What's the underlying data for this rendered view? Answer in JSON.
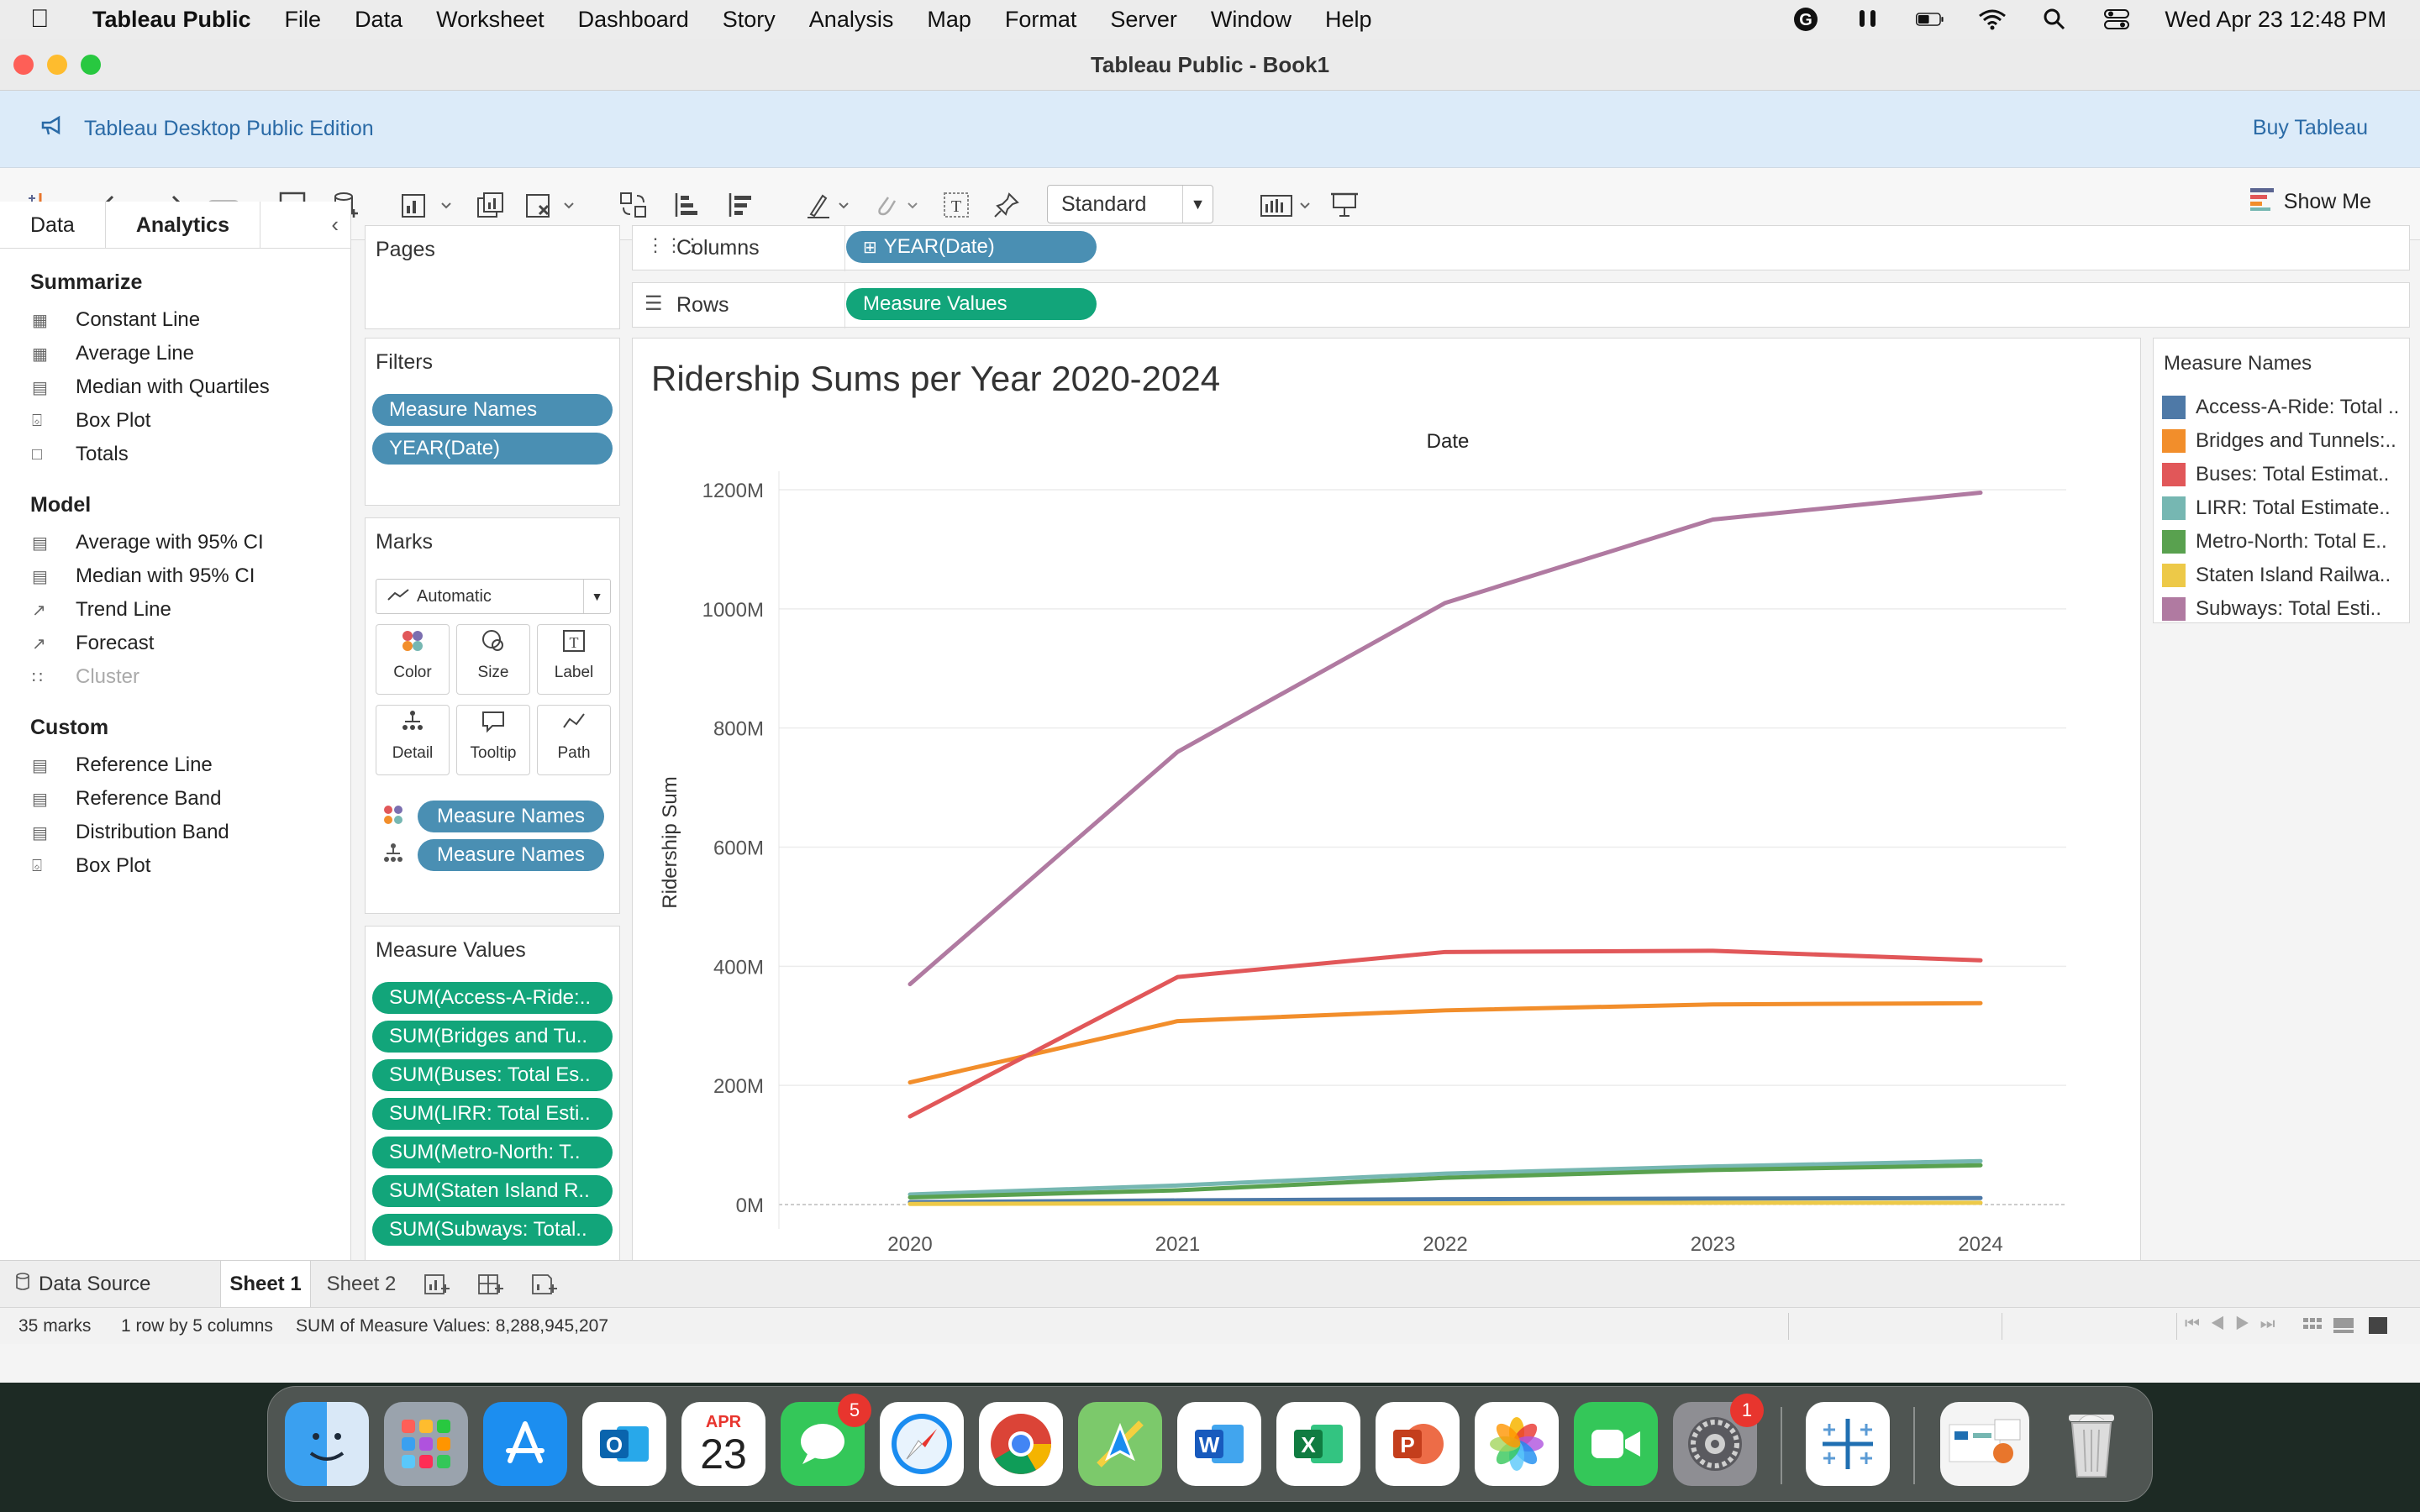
{
  "menubar": {
    "app_name": "Tableau Public",
    "items": [
      "File",
      "Data",
      "Worksheet",
      "Dashboard",
      "Story",
      "Analysis",
      "Map",
      "Format",
      "Server",
      "Window",
      "Help"
    ],
    "clock": "Wed Apr 23  12:48 PM"
  },
  "window": {
    "title": "Tableau Public - Book1",
    "banner_text": "Tableau Desktop Public Edition",
    "buy_label": "Buy Tableau"
  },
  "toolbar": {
    "fit_select": "Standard",
    "show_me": "Show Me"
  },
  "left_pane": {
    "tabs": [
      "Data",
      "Analytics"
    ],
    "active_tab": "Analytics",
    "sections": [
      {
        "title": "Summarize",
        "items": [
          "Constant Line",
          "Average Line",
          "Median with Quartiles",
          "Box Plot",
          "Totals"
        ]
      },
      {
        "title": "Model",
        "items": [
          "Average with 95% CI",
          "Median with 95% CI",
          "Trend Line",
          "Forecast",
          "Cluster"
        ]
      },
      {
        "title": "Custom",
        "items": [
          "Reference Line",
          "Reference Band",
          "Distribution Band",
          "Box Plot"
        ]
      }
    ]
  },
  "pages": {
    "title": "Pages"
  },
  "filters": {
    "title": "Filters",
    "pills": [
      "Measure Names",
      "YEAR(Date)"
    ]
  },
  "marks": {
    "title": "Marks",
    "type": "Automatic",
    "buttons": [
      "Color",
      "Size",
      "Label",
      "Detail",
      "Tooltip",
      "Path"
    ],
    "pills": [
      "Measure Names",
      "Measure Names"
    ]
  },
  "measure_values": {
    "title": "Measure Values",
    "pills": [
      "SUM(Access-A-Ride:..",
      "SUM(Bridges and Tu..",
      "SUM(Buses: Total Es..",
      "SUM(LIRR: Total Esti..",
      "SUM(Metro-North: T..",
      "SUM(Staten Island R..",
      "SUM(Subways: Total.."
    ]
  },
  "shelves": {
    "columns_label": "Columns",
    "columns_pill": "YEAR(Date)",
    "rows_label": "Rows",
    "rows_pill": "Measure Values"
  },
  "legend": {
    "title": "Measure Names",
    "entries": [
      {
        "label": "Access-A-Ride: Total ..",
        "color": "#4e79a7"
      },
      {
        "label": "Bridges and Tunnels:..",
        "color": "#f28e2b"
      },
      {
        "label": "Buses: Total Estimat..",
        "color": "#e15759"
      },
      {
        "label": "LIRR: Total Estimate..",
        "color": "#76b7b2"
      },
      {
        "label": "Metro-North: Total E..",
        "color": "#59a14f"
      },
      {
        "label": "Staten Island Railwa..",
        "color": "#edc948"
      },
      {
        "label": "Subways: Total Esti..",
        "color": "#b07aa1"
      }
    ]
  },
  "chart_data": {
    "type": "line",
    "title": "Ridership Sums per Year 2020-2024",
    "xlabel": "Date",
    "ylabel": "Ridership Sum",
    "x": [
      "2020",
      "2021",
      "2022",
      "2023",
      "2024"
    ],
    "y_ticks": [
      "0M",
      "200M",
      "400M",
      "600M",
      "800M",
      "1000M",
      "1200M"
    ],
    "ylim": [
      0,
      1200
    ],
    "series": [
      {
        "name": "Access-A-Ride: Total ..",
        "color": "#4e79a7",
        "values": [
          4,
          7,
          9,
          10,
          11
        ]
      },
      {
        "name": "Bridges and Tunnels:..",
        "color": "#f28e2b",
        "values": [
          205,
          308,
          326,
          336,
          338
        ]
      },
      {
        "name": "Buses: Total Estimat..",
        "color": "#e15759",
        "values": [
          148,
          382,
          424,
          426,
          410
        ]
      },
      {
        "name": "LIRR: Total Estimate..",
        "color": "#76b7b2",
        "values": [
          17,
          32,
          52,
          64,
          73
        ]
      },
      {
        "name": "Metro-North: Total E..",
        "color": "#59a14f",
        "values": [
          12,
          24,
          45,
          58,
          66
        ]
      },
      {
        "name": "Staten Island Railwa..",
        "color": "#edc948",
        "values": [
          1,
          2,
          2,
          3,
          3
        ]
      },
      {
        "name": "Subways: Total Esti..",
        "color": "#b07aa1",
        "values": [
          370,
          760,
          1010,
          1150,
          1195
        ]
      }
    ]
  },
  "sheet_tabs": {
    "data_source": "Data Source",
    "tabs": [
      "Sheet 1",
      "Sheet 2"
    ],
    "active": "Sheet 1"
  },
  "status": {
    "marks": "35 marks",
    "dims": "1 row by 5 columns",
    "sum": "SUM of Measure Values: 8,288,945,207"
  },
  "dock": {
    "calendar_month": "APR",
    "calendar_day": "23",
    "messages_badge": "5",
    "settings_badge": "1"
  }
}
